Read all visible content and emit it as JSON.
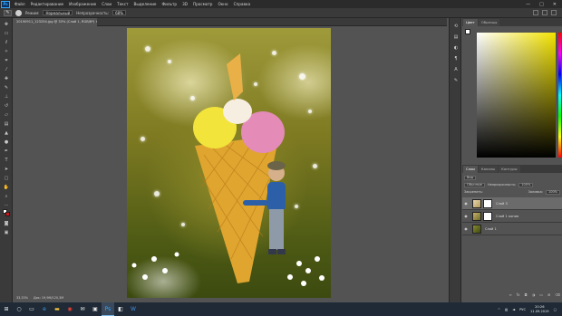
{
  "menubar": {
    "logo": "Ps",
    "items": [
      "Файл",
      "Редактирование",
      "Изображение",
      "Слои",
      "Текст",
      "Выделение",
      "Фильтр",
      "3D",
      "Просмотр",
      "Окно",
      "Справка"
    ],
    "window_buttons": [
      "—",
      "□",
      "✕"
    ]
  },
  "options_bar": {
    "mode_label": "Режим:",
    "mode_value": "Нормальный",
    "opacity_label": "Непрозрачность:",
    "opacity_value": "68%"
  },
  "document": {
    "tab_title": "20190911_123254.jpg @ 33% (Слой 1, RGB/8*) ✕",
    "status_zoom": "33,33%",
    "status_doc": "Док: 19,9M/120,3M"
  },
  "color_panel": {
    "tabs": [
      "Цвет",
      "Образцы"
    ],
    "fg_color": "#ffffff",
    "bg_color": "#d0141c"
  },
  "layers_panel": {
    "tabs": [
      "Слои",
      "Каналы",
      "Контуры"
    ],
    "kind_label": "Вид",
    "blend_mode": "Обычные",
    "opacity_label": "Непрозрачность:",
    "opacity_value": "100%",
    "lock_label": "Закрепить:",
    "fill_label": "Заливка:",
    "fill_value": "100%",
    "layers": [
      {
        "name": "Слой 3",
        "selected": true
      },
      {
        "name": "Слой 1 копия",
        "selected": false
      },
      {
        "name": "Слой 1",
        "selected": false
      }
    ]
  },
  "taskbar": {
    "language": "РУС",
    "time": "20:26",
    "date": "11.09.2019"
  }
}
